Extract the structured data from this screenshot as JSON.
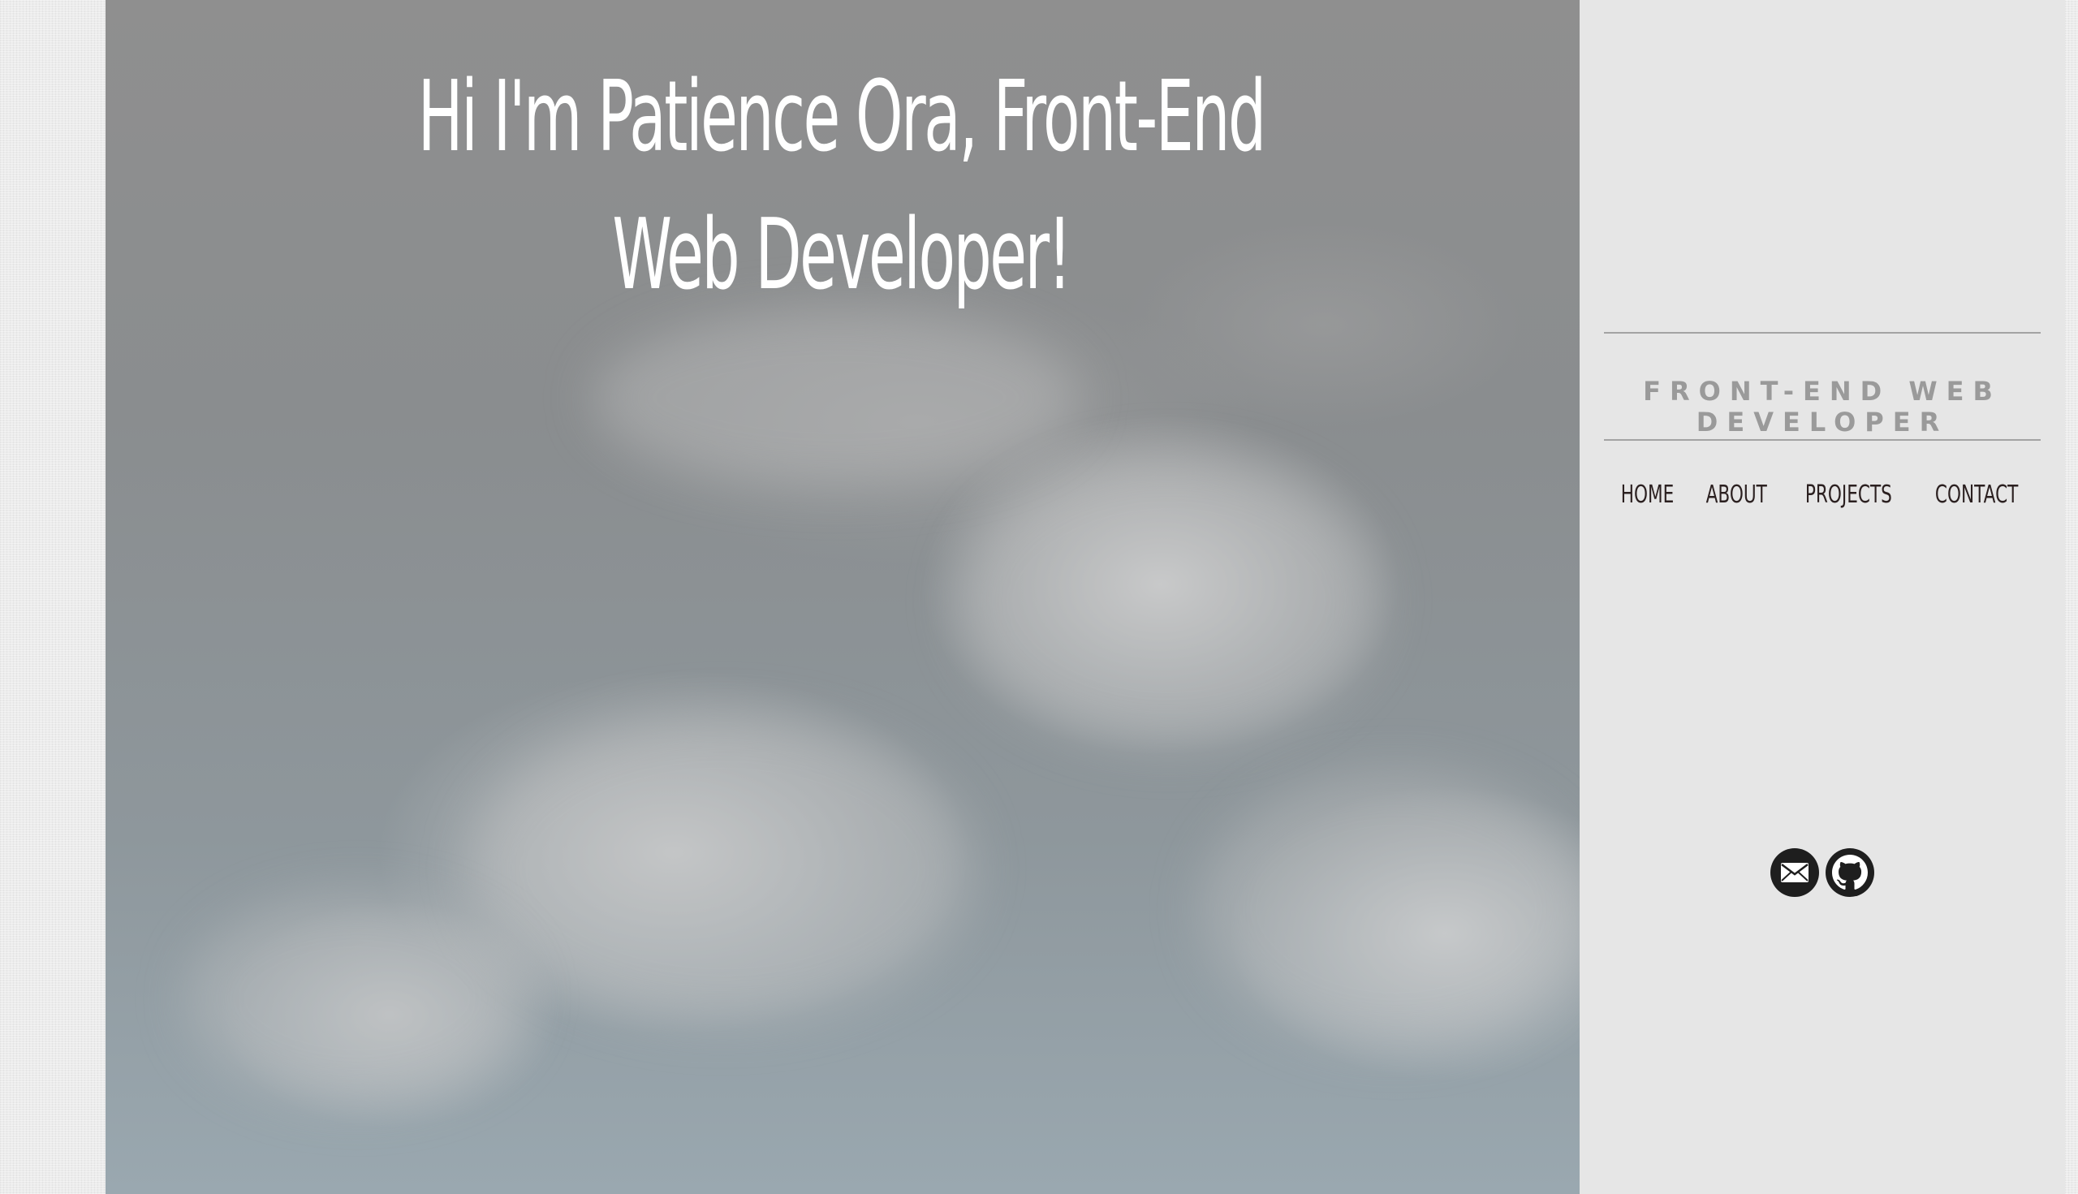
{
  "hero": {
    "title": "Hi I'm Patience Ora, Front-End Web Developer!"
  },
  "sidebar": {
    "tagline": "FRONT-END WEB DEVELOPER",
    "nav": [
      {
        "label": "HOME"
      },
      {
        "label": "ABOUT"
      },
      {
        "label": "PROJECTS"
      },
      {
        "label": "CONTACT"
      }
    ],
    "social": [
      {
        "icon": "mail-icon"
      },
      {
        "icon": "github-icon"
      }
    ]
  },
  "colors": {
    "sidebar_bg": "#e6e6e6",
    "tagline": "#9a9a9a",
    "nav_text": "#2b2020",
    "icon_bg": "#1e1e1e",
    "hero_text": "#ffffff"
  }
}
